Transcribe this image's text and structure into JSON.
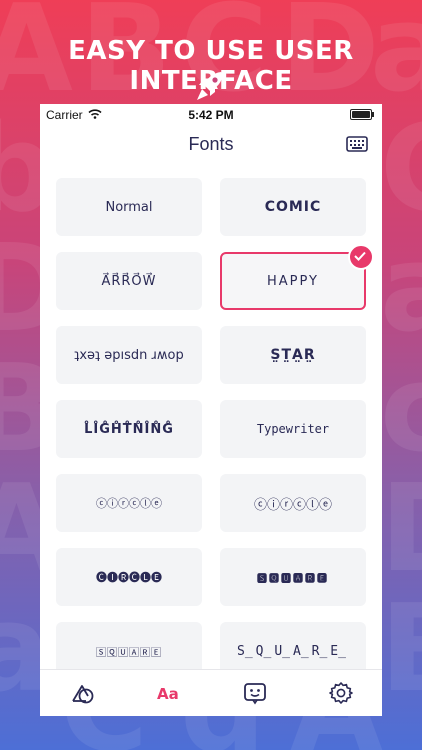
{
  "headline": "EASY TO USE USER INTERFACE",
  "status": {
    "carrier": "Carrier",
    "time": "5:42 PM"
  },
  "navbar": {
    "title": "Fonts"
  },
  "fonts": [
    {
      "label": "Normal"
    },
    {
      "label": "COMIC"
    },
    {
      "label": "A⃗R⃗R⃗O⃗W⃗"
    },
    {
      "label": "HAPPY",
      "selected": true
    },
    {
      "label": "ʇxǝʇ ǝpısdn ɹʍop"
    },
    {
      "label": "S̤T̤A̤R̤"
    },
    {
      "label": "L̊I̊G̊H̊T̊N̊I̊N̊G̊"
    },
    {
      "label": "Typewriter"
    },
    {
      "label": "ⓒⓘⓡⓒⓛⓔ"
    },
    {
      "label": "ⓒⓘⓡⓒⓛⓔ"
    },
    {
      "label": "🅒🅘🅡🅒🅛🅔"
    },
    {
      "label": "🆂🆀🆄🅰🆁🅴"
    },
    {
      "label": "🅂🅀🅄🄰🅁🄴"
    },
    {
      "label": "S̲Q̲U̲A̲R̲E̲"
    }
  ],
  "colors": {
    "accent": "#e8396a",
    "text": "#2a2a55"
  },
  "tabs": [
    "shapes-icon",
    "fonts-icon",
    "keyboard-face-icon",
    "settings-icon"
  ]
}
